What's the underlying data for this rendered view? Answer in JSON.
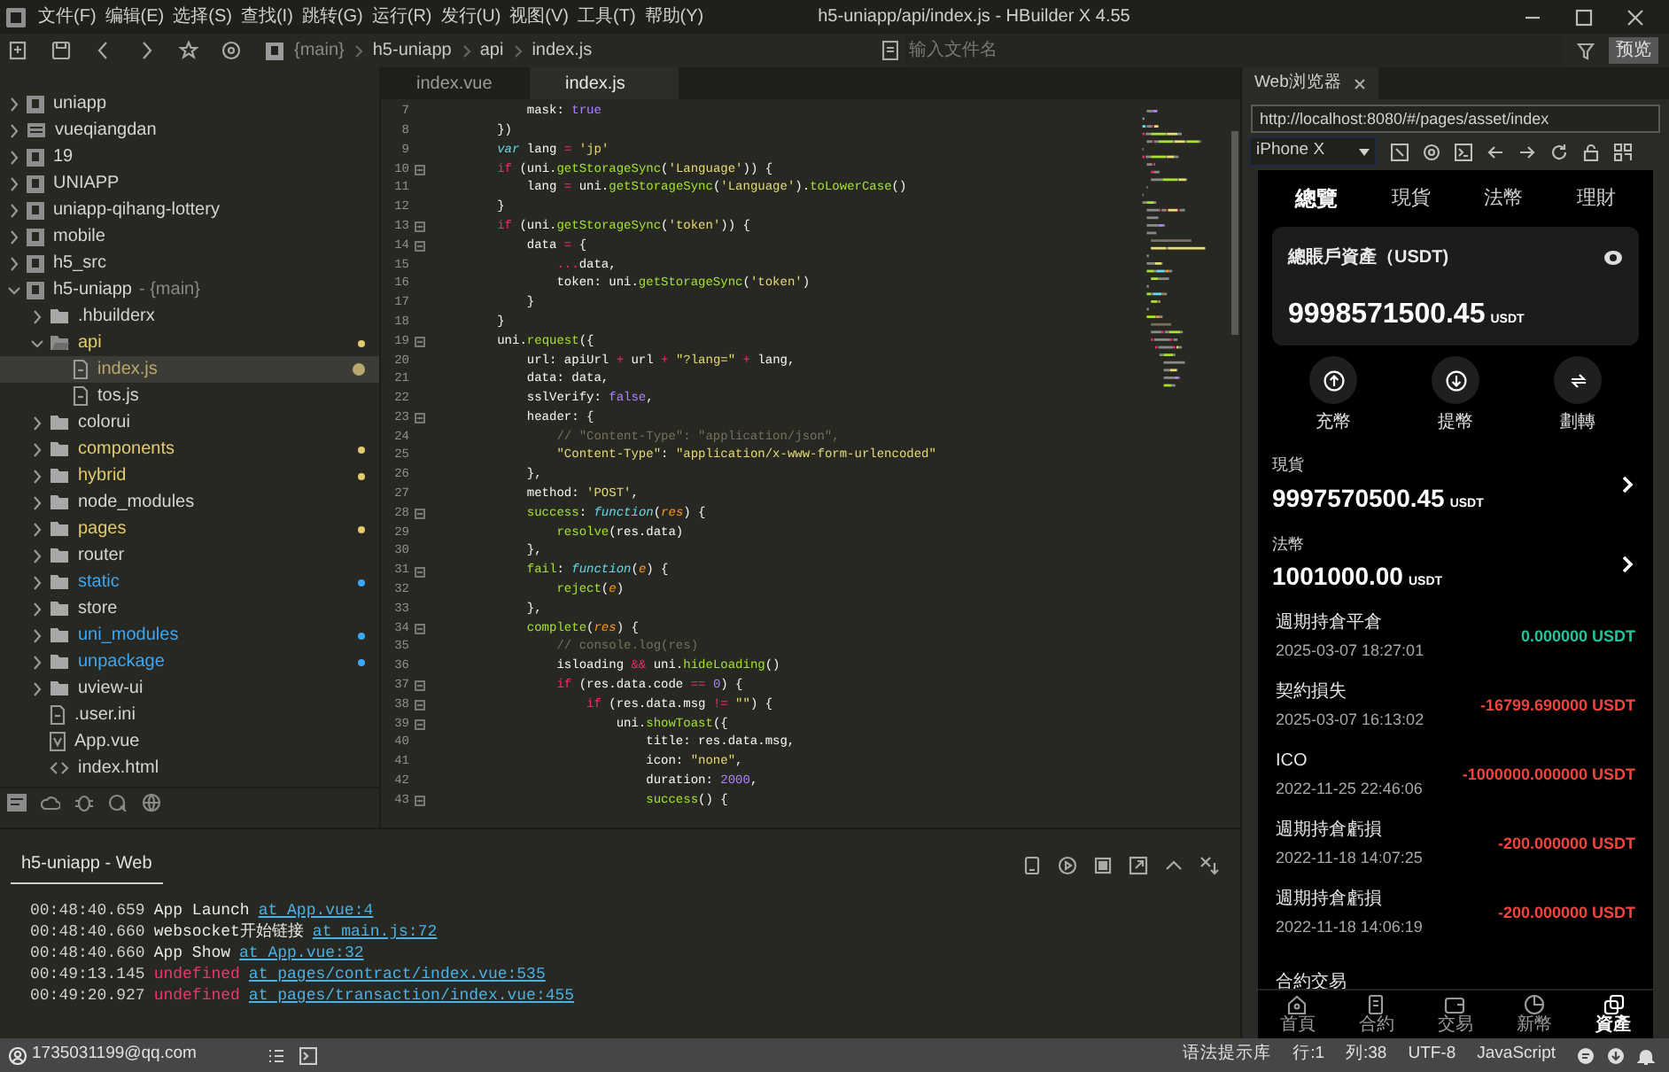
{
  "window": {
    "title": "h5-uniapp/api/index.js - HBuilder X 4.55"
  },
  "menu": [
    "文件(F)",
    "编辑(E)",
    "选择(S)",
    "查找(I)",
    "跳转(G)",
    "运行(R)",
    "发行(U)",
    "视图(V)",
    "工具(T)",
    "帮助(Y)"
  ],
  "toolbar": {
    "breadcrumb": [
      "{main}",
      "h5-uniapp",
      "api",
      "index.js"
    ],
    "file_search": {
      "placeholder": "输入文件名"
    },
    "preview_button": "预览"
  },
  "project_tree": [
    {
      "label": "uniapp",
      "kind": "project",
      "expanded": false,
      "selected": false
    },
    {
      "label": "vueqiangdan",
      "kind": "directory",
      "expanded": false,
      "selected": false
    },
    {
      "label": "19",
      "kind": "project",
      "expanded": false,
      "selected": false
    },
    {
      "label": "UNIAPP",
      "kind": "project",
      "expanded": false,
      "selected": false
    },
    {
      "label": "uniapp-qihang-lottery",
      "kind": "project",
      "expanded": false,
      "selected": false
    },
    {
      "label": "mobile",
      "kind": "project",
      "expanded": false,
      "selected": false
    },
    {
      "label": "h5_src",
      "kind": "project",
      "expanded": false,
      "selected": false
    },
    {
      "label": "h5-uniapp",
      "branch": "- {main}",
      "kind": "project",
      "expanded": true,
      "selected": false,
      "children": [
        {
          "label": ".hbuilderx",
          "kind": "folder",
          "expanded": false,
          "selected": false
        },
        {
          "label": "api",
          "kind": "folder",
          "expanded": true,
          "selected": false,
          "color": "#e2cb6f",
          "children": [
            {
              "label": "index.js",
              "kind": "file",
              "selected": true,
              "color": "#b9a86e"
            },
            {
              "label": "tos.js",
              "kind": "file",
              "selected": false
            }
          ]
        },
        {
          "label": "colorui",
          "kind": "folder",
          "expanded": false,
          "selected": false
        },
        {
          "label": "components",
          "kind": "folder",
          "expanded": false,
          "selected": false,
          "color": "#e2cb6f"
        },
        {
          "label": "hybrid",
          "kind": "folder",
          "expanded": false,
          "selected": false,
          "color": "#e2cb6f"
        },
        {
          "label": "node_modules",
          "kind": "folder",
          "expanded": false,
          "selected": false
        },
        {
          "label": "pages",
          "kind": "folder",
          "expanded": false,
          "selected": false,
          "color": "#e2cb6f"
        },
        {
          "label": "router",
          "kind": "folder",
          "expanded": false,
          "selected": false
        },
        {
          "label": "static",
          "kind": "folder",
          "expanded": false,
          "selected": false,
          "color": "#3ea6f2"
        },
        {
          "label": "store",
          "kind": "folder",
          "expanded": false,
          "selected": false
        },
        {
          "label": "uni_modules",
          "kind": "folder",
          "expanded": false,
          "selected": false,
          "color": "#3ea6f2"
        },
        {
          "label": "unpackage",
          "kind": "folder",
          "expanded": false,
          "selected": false,
          "color": "#3ea6f2"
        },
        {
          "label": "uview-ui",
          "kind": "folder",
          "expanded": false,
          "selected": false
        },
        {
          "label": ".user.ini",
          "kind": "file",
          "selected": false
        },
        {
          "label": "App.vue",
          "kind": "vue",
          "selected": false
        },
        {
          "label": "index.html",
          "kind": "html",
          "selected": false
        }
      ]
    }
  ],
  "editor": {
    "tabs": [
      {
        "label": "index.vue",
        "selected": false
      },
      {
        "label": "index.js",
        "selected": true
      }
    ],
    "lines": [
      {
        "number": "7",
        "fold": false,
        "tokens": [
          {
            "text": "            mask: ",
            "kind": "plain"
          },
          {
            "text": "true",
            "kind": "constant"
          }
        ]
      },
      {
        "number": "8",
        "fold": false,
        "tokens": [
          {
            "text": "        })",
            "kind": "plain"
          }
        ]
      },
      {
        "number": "9",
        "fold": false,
        "tokens": [
          {
            "text": "        var",
            "kind": "type"
          },
          {
            "text": " lang ",
            "kind": "plain"
          },
          {
            "text": "=",
            "kind": "operator"
          },
          {
            "text": " 'jp'",
            "kind": "string"
          }
        ]
      },
      {
        "number": "10",
        "fold": true,
        "tokens": [
          {
            "text": "        if",
            "kind": "keyword"
          },
          {
            "text": " (uni.",
            "kind": "plain"
          },
          {
            "text": "getStorageSync",
            "kind": "function"
          },
          {
            "text": "(",
            "kind": "plain"
          },
          {
            "text": "'Language'",
            "kind": "string"
          },
          {
            "text": ")) {",
            "kind": "plain"
          }
        ]
      },
      {
        "number": "11",
        "fold": false,
        "tokens": [
          {
            "text": "            lang ",
            "kind": "plain"
          },
          {
            "text": "=",
            "kind": "operator"
          },
          {
            "text": " uni.",
            "kind": "plain"
          },
          {
            "text": "getStorageSync",
            "kind": "function"
          },
          {
            "text": "(",
            "kind": "plain"
          },
          {
            "text": "'Language'",
            "kind": "string"
          },
          {
            "text": ").",
            "kind": "plain"
          },
          {
            "text": "toLowerCase",
            "kind": "function"
          },
          {
            "text": "()",
            "kind": "plain"
          }
        ]
      },
      {
        "number": "12",
        "fold": false,
        "tokens": [
          {
            "text": "        }",
            "kind": "plain"
          }
        ]
      },
      {
        "number": "13",
        "fold": true,
        "tokens": [
          {
            "text": "        if",
            "kind": "keyword"
          },
          {
            "text": " (uni.",
            "kind": "plain"
          },
          {
            "text": "getStorageSync",
            "kind": "function"
          },
          {
            "text": "(",
            "kind": "plain"
          },
          {
            "text": "'token'",
            "kind": "string"
          },
          {
            "text": ")) {",
            "kind": "plain"
          }
        ]
      },
      {
        "number": "14",
        "fold": true,
        "tokens": [
          {
            "text": "            data ",
            "kind": "plain"
          },
          {
            "text": "=",
            "kind": "operator"
          },
          {
            "text": " {",
            "kind": "plain"
          }
        ]
      },
      {
        "number": "15",
        "fold": false,
        "tokens": [
          {
            "text": "                ...",
            "kind": "operator"
          },
          {
            "text": "data,",
            "kind": "plain"
          }
        ]
      },
      {
        "number": "16",
        "fold": false,
        "tokens": [
          {
            "text": "                token: uni.",
            "kind": "plain"
          },
          {
            "text": "getStorageSync",
            "kind": "function"
          },
          {
            "text": "(",
            "kind": "plain"
          },
          {
            "text": "'token'",
            "kind": "string"
          },
          {
            "text": ")",
            "kind": "plain"
          }
        ]
      },
      {
        "number": "17",
        "fold": false,
        "tokens": [
          {
            "text": "            }",
            "kind": "plain"
          }
        ]
      },
      {
        "number": "18",
        "fold": false,
        "tokens": [
          {
            "text": "        }",
            "kind": "plain"
          }
        ]
      },
      {
        "number": "19",
        "fold": true,
        "tokens": [
          {
            "text": "        uni.",
            "kind": "plain"
          },
          {
            "text": "request",
            "kind": "function"
          },
          {
            "text": "({",
            "kind": "plain"
          }
        ]
      },
      {
        "number": "20",
        "fold": false,
        "tokens": [
          {
            "text": "            url: apiUrl ",
            "kind": "plain"
          },
          {
            "text": "+",
            "kind": "operator"
          },
          {
            "text": " url ",
            "kind": "plain"
          },
          {
            "text": "+",
            "kind": "operator"
          },
          {
            "text": " \"?lang=\" ",
            "kind": "string"
          },
          {
            "text": "+",
            "kind": "operator"
          },
          {
            "text": " lang,",
            "kind": "plain"
          }
        ]
      },
      {
        "number": "21",
        "fold": false,
        "tokens": [
          {
            "text": "            data: data,",
            "kind": "plain"
          }
        ]
      },
      {
        "number": "22",
        "fold": false,
        "tokens": [
          {
            "text": "            sslVerify: ",
            "kind": "plain"
          },
          {
            "text": "false",
            "kind": "constant"
          },
          {
            "text": ",",
            "kind": "plain"
          }
        ]
      },
      {
        "number": "23",
        "fold": true,
        "tokens": [
          {
            "text": "            header: {",
            "kind": "plain"
          }
        ]
      },
      {
        "number": "24",
        "fold": false,
        "tokens": [
          {
            "text": "                // \"Content-Type\": \"application/json\",",
            "kind": "comment"
          }
        ]
      },
      {
        "number": "25",
        "fold": false,
        "tokens": [
          {
            "text": "                \"Content-Type\"",
            "kind": "string"
          },
          {
            "text": ": ",
            "kind": "plain"
          },
          {
            "text": "\"application/x-www-form-urlencoded\"",
            "kind": "string"
          }
        ]
      },
      {
        "number": "26",
        "fold": false,
        "tokens": [
          {
            "text": "            },",
            "kind": "plain"
          }
        ]
      },
      {
        "number": "27",
        "fold": false,
        "tokens": [
          {
            "text": "            method: ",
            "kind": "plain"
          },
          {
            "text": "'POST'",
            "kind": "string"
          },
          {
            "text": ",",
            "kind": "plain"
          }
        ]
      },
      {
        "number": "28",
        "fold": true,
        "tokens": [
          {
            "text": "            success",
            "kind": "function"
          },
          {
            "text": ": ",
            "kind": "plain"
          },
          {
            "text": "function",
            "kind": "type"
          },
          {
            "text": "(",
            "kind": "plain"
          },
          {
            "text": "res",
            "kind": "param"
          },
          {
            "text": ") {",
            "kind": "plain"
          }
        ]
      },
      {
        "number": "29",
        "fold": false,
        "tokens": [
          {
            "text": "                resolve",
            "kind": "function"
          },
          {
            "text": "(res.data)",
            "kind": "plain"
          }
        ]
      },
      {
        "number": "30",
        "fold": false,
        "tokens": [
          {
            "text": "            },",
            "kind": "plain"
          }
        ]
      },
      {
        "number": "31",
        "fold": true,
        "tokens": [
          {
            "text": "            fail",
            "kind": "function"
          },
          {
            "text": ": ",
            "kind": "plain"
          },
          {
            "text": "function",
            "kind": "type"
          },
          {
            "text": "(",
            "kind": "plain"
          },
          {
            "text": "e",
            "kind": "param"
          },
          {
            "text": ") {",
            "kind": "plain"
          }
        ]
      },
      {
        "number": "32",
        "fold": false,
        "tokens": [
          {
            "text": "                reject",
            "kind": "function"
          },
          {
            "text": "(",
            "kind": "plain"
          },
          {
            "text": "e",
            "kind": "param"
          },
          {
            "text": ")",
            "kind": "plain"
          }
        ]
      },
      {
        "number": "33",
        "fold": false,
        "tokens": [
          {
            "text": "            },",
            "kind": "plain"
          }
        ]
      },
      {
        "number": "34",
        "fold": true,
        "tokens": [
          {
            "text": "            complete",
            "kind": "function"
          },
          {
            "text": "(",
            "kind": "plain"
          },
          {
            "text": "res",
            "kind": "param"
          },
          {
            "text": ") {",
            "kind": "plain"
          }
        ]
      },
      {
        "number": "35",
        "fold": false,
        "tokens": [
          {
            "text": "                // console.log(res)",
            "kind": "comment"
          }
        ]
      },
      {
        "number": "36",
        "fold": false,
        "tokens": [
          {
            "text": "                isloading ",
            "kind": "plain"
          },
          {
            "text": "&&",
            "kind": "operator"
          },
          {
            "text": " uni.",
            "kind": "plain"
          },
          {
            "text": "hideLoading",
            "kind": "function"
          },
          {
            "text": "()",
            "kind": "plain"
          }
        ]
      },
      {
        "number": "37",
        "fold": true,
        "tokens": [
          {
            "text": "                if",
            "kind": "keyword"
          },
          {
            "text": " (res.data.code ",
            "kind": "plain"
          },
          {
            "text": "==",
            "kind": "operator"
          },
          {
            "text": " 0",
            "kind": "constant"
          },
          {
            "text": ") {",
            "kind": "plain"
          }
        ]
      },
      {
        "number": "38",
        "fold": true,
        "tokens": [
          {
            "text": "                    if",
            "kind": "keyword"
          },
          {
            "text": " (res.data.msg ",
            "kind": "plain"
          },
          {
            "text": "!=",
            "kind": "operator"
          },
          {
            "text": " \"\"",
            "kind": "string"
          },
          {
            "text": ") {",
            "kind": "plain"
          }
        ]
      },
      {
        "number": "39",
        "fold": true,
        "tokens": [
          {
            "text": "                        uni.",
            "kind": "plain"
          },
          {
            "text": "showToast",
            "kind": "function"
          },
          {
            "text": "({",
            "kind": "plain"
          }
        ]
      },
      {
        "number": "40",
        "fold": false,
        "tokens": [
          {
            "text": "                            title: res.data.msg,",
            "kind": "plain"
          }
        ]
      },
      {
        "number": "41",
        "fold": false,
        "tokens": [
          {
            "text": "                            icon: ",
            "kind": "plain"
          },
          {
            "text": "\"none\"",
            "kind": "string"
          },
          {
            "text": ",",
            "kind": "plain"
          }
        ]
      },
      {
        "number": "42",
        "fold": false,
        "tokens": [
          {
            "text": "                            duration: ",
            "kind": "plain"
          },
          {
            "text": "2000",
            "kind": "constant"
          },
          {
            "text": ",",
            "kind": "plain"
          }
        ]
      },
      {
        "number": "43",
        "fold": true,
        "tokens": [
          {
            "text": "                            success",
            "kind": "function"
          },
          {
            "text": "() {",
            "kind": "plain"
          }
        ]
      }
    ]
  },
  "console": {
    "tab": "h5-uniapp - Web",
    "logs": [
      {
        "time": "00:48:40.659",
        "message": "App Launch",
        "kind": "info",
        "link": "at App.vue:4"
      },
      {
        "time": "00:48:40.660",
        "message": "websocket开始链接",
        "kind": "info",
        "link": "at main.js:72"
      },
      {
        "time": "00:48:40.660",
        "message": "App Show",
        "kind": "info",
        "link": "at App.vue:32"
      },
      {
        "time": "00:49:13.145",
        "message": "undefined",
        "kind": "error",
        "link": "at pages/contract/index.vue:535"
      },
      {
        "time": "00:49:20.927",
        "message": "undefined",
        "kind": "error",
        "link": "at pages/transaction/index.vue:455"
      }
    ]
  },
  "preview": {
    "tab": "Web浏览器",
    "url": "http://localhost:8080/#/pages/asset/index",
    "device": "iPhone X",
    "app": {
      "tabs": [
        {
          "label": "總覽",
          "selected": true
        },
        {
          "label": "現貨",
          "selected": false
        },
        {
          "label": "法幣",
          "selected": false
        },
        {
          "label": "理財",
          "selected": false
        }
      ],
      "total": {
        "label": "總賬戶資產（USDT)",
        "amount": "9998571500.45",
        "unit": "USDT"
      },
      "actions": [
        {
          "label": "充幣",
          "kind": "deposit"
        },
        {
          "label": "提幣",
          "kind": "withdraw"
        },
        {
          "label": "劃轉",
          "kind": "transfer"
        }
      ],
      "accounts": [
        {
          "label": "現貨",
          "amount": "9997570500.45",
          "unit": "USDT"
        },
        {
          "label": "法幣",
          "amount": "1001000.00",
          "unit": "USDT"
        }
      ],
      "records": [
        {
          "title": "週期持倉平倉",
          "time": "2025-03-07 18:27:01",
          "amount": "0.000000 USDT",
          "color": "#22c39a"
        },
        {
          "title": "契約損失",
          "time": "2025-03-07 16:13:02",
          "amount": "-16799.690000 USDT",
          "color": "#f0443c"
        },
        {
          "title": "ICO",
          "time": "2022-11-25 22:46:06",
          "amount": "-1000000.000000 USDT",
          "color": "#f0443c"
        },
        {
          "title": "週期持倉虧損",
          "time": "2022-11-18 14:07:25",
          "amount": "-200.000000 USDT",
          "color": "#f0443c"
        },
        {
          "title": "週期持倉虧損",
          "time": "2022-11-18 14:06:19",
          "amount": "-200.000000 USDT",
          "color": "#f0443c"
        },
        {
          "title": "合約交易"
        }
      ],
      "nav": [
        {
          "label": "首頁",
          "kind": "home",
          "selected": false
        },
        {
          "label": "合約",
          "kind": "contract",
          "selected": false
        },
        {
          "label": "交易",
          "kind": "wallet",
          "selected": false
        },
        {
          "label": "新幣",
          "kind": "chart",
          "selected": false
        },
        {
          "label": "資產",
          "kind": "assets",
          "selected": true
        }
      ]
    }
  },
  "status_bar": {
    "account": "1735031199@qq.com",
    "items": [
      "语法提示库",
      "行:1",
      "列:38",
      "UTF-8",
      "JavaScript"
    ]
  }
}
